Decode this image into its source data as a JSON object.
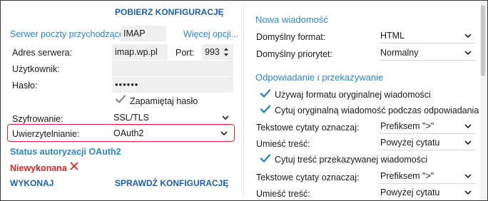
{
  "left": {
    "header": "POBIERZ KONFIGURACJĘ",
    "incoming_server_label": "Serwer poczty przychodzącej:",
    "incoming_server_value": "IMAP",
    "more_options_link": "Więcej opcji...",
    "server_address_label": "Adres serwera:",
    "server_address_value": "imap.wp.pl",
    "port_label": "Port:",
    "port_value": "993",
    "user_label": "Użytkownik:",
    "user_value": "",
    "password_label": "Hasło:",
    "password_value": "••••••",
    "remember_password_label": "Zapamiętaj hasło",
    "encryption_label": "Szyfrowanie:",
    "encryption_value": "SSL/TLS",
    "auth_label": "Uwierzytelnianie:",
    "auth_value": "OAuth2",
    "oauth_status_label": "Status autoryzacji OAuth2",
    "oauth_status_value": "Niewykonana",
    "run_button": "WYKONAJ",
    "check_config_button": "SPRAWDŹ KONFIGURACJĘ"
  },
  "right": {
    "new_message_header": "Nowa wiadomość",
    "default_format_label": "Domyślny format:",
    "default_format_value": "HTML",
    "default_priority_label": "Domyślny priorytet:",
    "default_priority_value": "Normalny",
    "reply_forward_header": "Odpowiadanie i przekazywanie",
    "use_original_format_label": "Używaj formatu oryginalnej wiadomości",
    "quote_original_label": "Cytuj oryginalną wiadomość podczas odpowiadania",
    "quote_mark_label_1": "Tekstowe cytaty oznaczaj:",
    "quote_mark_value_1": "Prefiksem \">\"",
    "place_content_label_1": "Umieść treść:",
    "place_content_value_1": "Powyżej cytatu",
    "quote_forwarded_label": "Cytuj treść przekazywanej wiadomości",
    "quote_mark_label_2": "Tekstowe cytaty oznaczaj:",
    "quote_mark_value_2": "Prefiksem \">\"",
    "place_content_label_2": "Umieść treść:",
    "place_content_value_2": "Powyżej cytatu"
  },
  "colors": {
    "accent_blue": "#2b86c5",
    "header_blue": "#1f5fa8",
    "error_red": "#d9262b",
    "field_bg": "#efefef"
  },
  "icons": {
    "check": "check-icon",
    "chevron": "chevron-down-icon",
    "error": "x-icon",
    "spinner": "spinner-arrows-icon"
  }
}
